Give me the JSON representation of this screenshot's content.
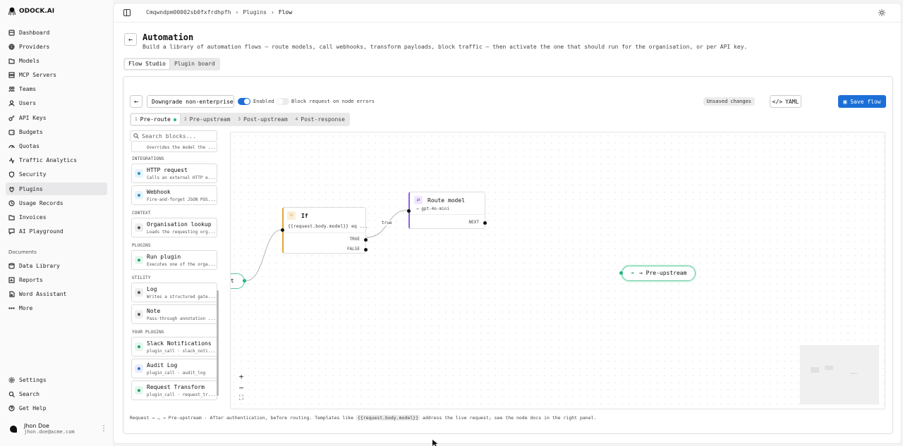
{
  "app": {
    "name": "ODOCK.AI"
  },
  "sidebar": {
    "items": [
      {
        "label": "Dashboard",
        "icon": "dashboard-icon"
      },
      {
        "label": "Providers",
        "icon": "globe-icon"
      },
      {
        "label": "Models",
        "icon": "folder-icon"
      },
      {
        "label": "MCP Servers",
        "icon": "server-icon"
      },
      {
        "label": "Teams",
        "icon": "teams-icon"
      },
      {
        "label": "Users",
        "icon": "users-icon"
      },
      {
        "label": "API Keys",
        "icon": "key-icon"
      },
      {
        "label": "Budgets",
        "icon": "wallet-icon"
      },
      {
        "label": "Quotas",
        "icon": "gauge-icon"
      },
      {
        "label": "Traffic Analytics",
        "icon": "activity-icon"
      },
      {
        "label": "Security",
        "icon": "shield-icon"
      },
      {
        "label": "Plugins",
        "icon": "plug-icon",
        "active": true
      },
      {
        "label": "Usage Records",
        "icon": "records-icon"
      },
      {
        "label": "Invoices",
        "icon": "invoice-icon"
      },
      {
        "label": "AI Playground",
        "icon": "chat-icon"
      }
    ],
    "documents_label": "Documents",
    "doc_items": [
      {
        "label": "Data Library",
        "icon": "library-icon"
      },
      {
        "label": "Reports",
        "icon": "reports-icon"
      },
      {
        "label": "Word Assistant",
        "icon": "doc-icon"
      },
      {
        "label": "More",
        "icon": "more-icon"
      }
    ],
    "bottom_items": [
      {
        "label": "Settings",
        "icon": "gear-icon"
      },
      {
        "label": "Search",
        "icon": "search-icon"
      },
      {
        "label": "Get Help",
        "icon": "help-icon"
      }
    ],
    "user": {
      "name": "Jhon Doe",
      "email": "jhon.doe@acme.com"
    }
  },
  "breadcrumb": [
    "Cmqwndpm00002sb0fxfrdhpfh",
    "Plugins",
    "Flow"
  ],
  "page": {
    "title": "Automation",
    "subtitle": "Build a library of automation flows — route models, call webhooks, transform payloads, block traffic — then activate the one that should run for the organisation, or per API key."
  },
  "view_tabs": [
    {
      "label": "Flow Studio",
      "active": true
    },
    {
      "label": "Plugin board",
      "active": false
    }
  ],
  "editor": {
    "flow_name": "Downgrade non-enterprise",
    "enabled_label": "Enabled",
    "enabled": true,
    "block_label": "Block request on node errors",
    "block_on_errors": false,
    "unsaved_label": "Unsaved changes",
    "yaml_label": "YAML",
    "save_label": "Save flow"
  },
  "stages": [
    {
      "num": "1",
      "label": "Pre-route",
      "active": true
    },
    {
      "num": "2",
      "label": "Pre-upstream",
      "active": false
    },
    {
      "num": "3",
      "label": "Post-upstream",
      "active": false
    },
    {
      "num": "4",
      "label": "Post-response",
      "active": false
    }
  ],
  "palette": {
    "search_placeholder": "Search blocks...",
    "partial_desc": "Overrides the model the ...",
    "categories": [
      {
        "label": "INTEGRATIONS",
        "blocks": [
          {
            "name": "HTTP request",
            "desc": "Calls an external HTTP e...",
            "icon": "globe-icon",
            "color": "#e6f3fb",
            "fg": "#2a8fc7"
          },
          {
            "name": "Webhook",
            "desc": "Fire-and-forget JSON POS...",
            "icon": "webhook-icon",
            "color": "#e6f3fb",
            "fg": "#2a8fc7"
          }
        ]
      },
      {
        "label": "CONTEXT",
        "blocks": [
          {
            "name": "Organisation lookup",
            "desc": "Loads the requesting org...",
            "icon": "building-icon",
            "color": "#eeeeee",
            "fg": "#555555"
          }
        ]
      },
      {
        "label": "PLUGINS",
        "blocks": [
          {
            "name": "Run plugin",
            "desc": "Executes one of the orga...",
            "icon": "plug-icon",
            "color": "#e4f6ec",
            "fg": "#21a06a"
          }
        ]
      },
      {
        "label": "UTILITY",
        "blocks": [
          {
            "name": "Log",
            "desc": "Writes a structured gate...",
            "icon": "log-icon",
            "color": "#eeeeee",
            "fg": "#555555"
          },
          {
            "name": "Note",
            "desc": "Pass-through annotation ...",
            "icon": "note-icon",
            "color": "#eeeeee",
            "fg": "#555555"
          }
        ]
      },
      {
        "label": "YOUR PLUGINS",
        "blocks": [
          {
            "name": "Slack Notifications",
            "desc": "plugin_call · slack_noti...",
            "icon": "plug-icon",
            "color": "#e4f6ec",
            "fg": "#21a06a"
          },
          {
            "name": "Audit Log",
            "desc": "plugin_call · audit_log",
            "icon": "plug-icon",
            "color": "#e8eefb",
            "fg": "#3b6fd8"
          },
          {
            "name": "Request Transform",
            "desc": "plugin_call · request_tr...",
            "icon": "plug-icon",
            "color": "#e4f6ec",
            "fg": "#21a06a"
          }
        ]
      }
    ]
  },
  "canvas": {
    "request_node_label": "st",
    "if_node": {
      "title": "If",
      "expr": "{{request.body.model}} eq ...",
      "true_label": "TRUE",
      "false_label": "FALSE"
    },
    "edge_label": "true",
    "route_node": {
      "title": "Route model",
      "detail": "→ gpt-4o-mini",
      "next_label": "NEXT"
    },
    "pre_upstream_node": "→ Pre-upstream",
    "zoom": [
      "+",
      "−",
      "⛶"
    ]
  },
  "footer": {
    "prefix": "Request → … → Pre-upstream · After authentication, before routing. Templates like",
    "code": "{{request.body.model}}",
    "suffix": "address the live request; see the node docs in the right panel."
  },
  "colors": {
    "accent": "#1d6fd8",
    "success": "#21b47a",
    "if": "#e0a53a",
    "route": "#8b63d9"
  }
}
